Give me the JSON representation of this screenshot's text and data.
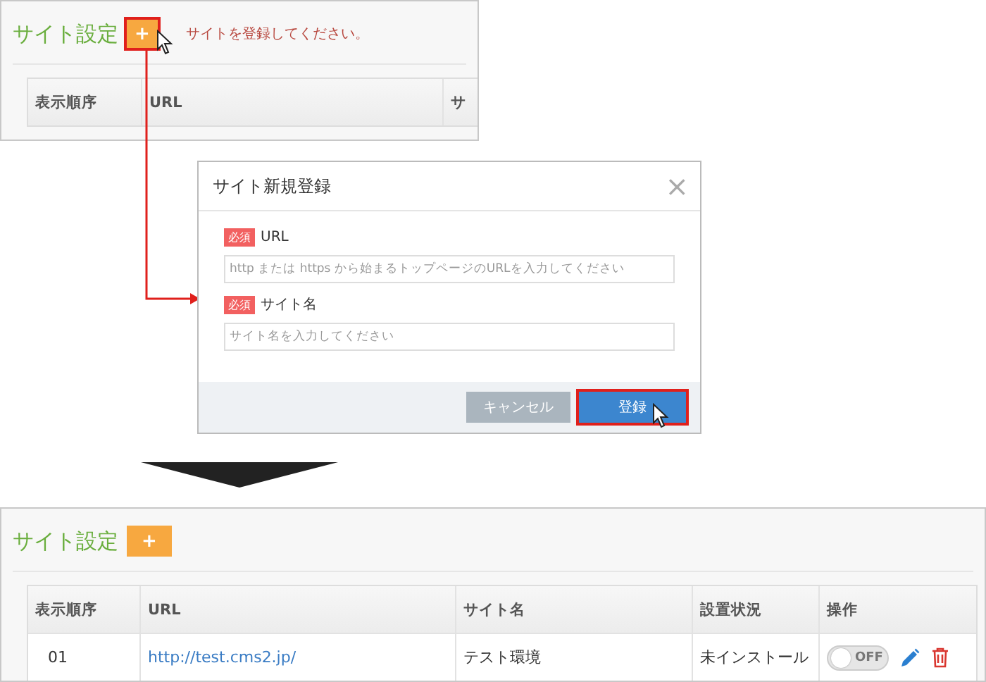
{
  "step1": {
    "title": "サイト設定",
    "add_button": {
      "label": "+",
      "highlighted": true
    },
    "message": "サイトを登録してください。",
    "columns": [
      "表示順序",
      "URL",
      "サ"
    ]
  },
  "dialog": {
    "title": "サイト新規登録",
    "close": "×",
    "fields": [
      {
        "required": "必須",
        "label": "URL",
        "placeholder": "http または https から始まるトップページのURLを入力してください"
      },
      {
        "required": "必須",
        "label": "サイト名",
        "placeholder": "サイト名を入力してください"
      }
    ],
    "buttons": [
      {
        "label": "キャンセル",
        "kind": "secondary",
        "highlighted": false
      },
      {
        "label": "登録",
        "kind": "primary",
        "highlighted": true
      }
    ]
  },
  "result": {
    "title": "サイト設定",
    "add_button": {
      "label": "+",
      "highlighted": false
    },
    "columns": [
      "表示順序",
      "URL",
      "サイト名",
      "設置状況",
      "操作"
    ],
    "rows": [
      {
        "order": "01",
        "url": "http://test.cms2.jp/",
        "name": "テスト環境",
        "status": "未インストール",
        "toggle": {
          "label": "OFF",
          "on": false
        }
      }
    ]
  }
}
